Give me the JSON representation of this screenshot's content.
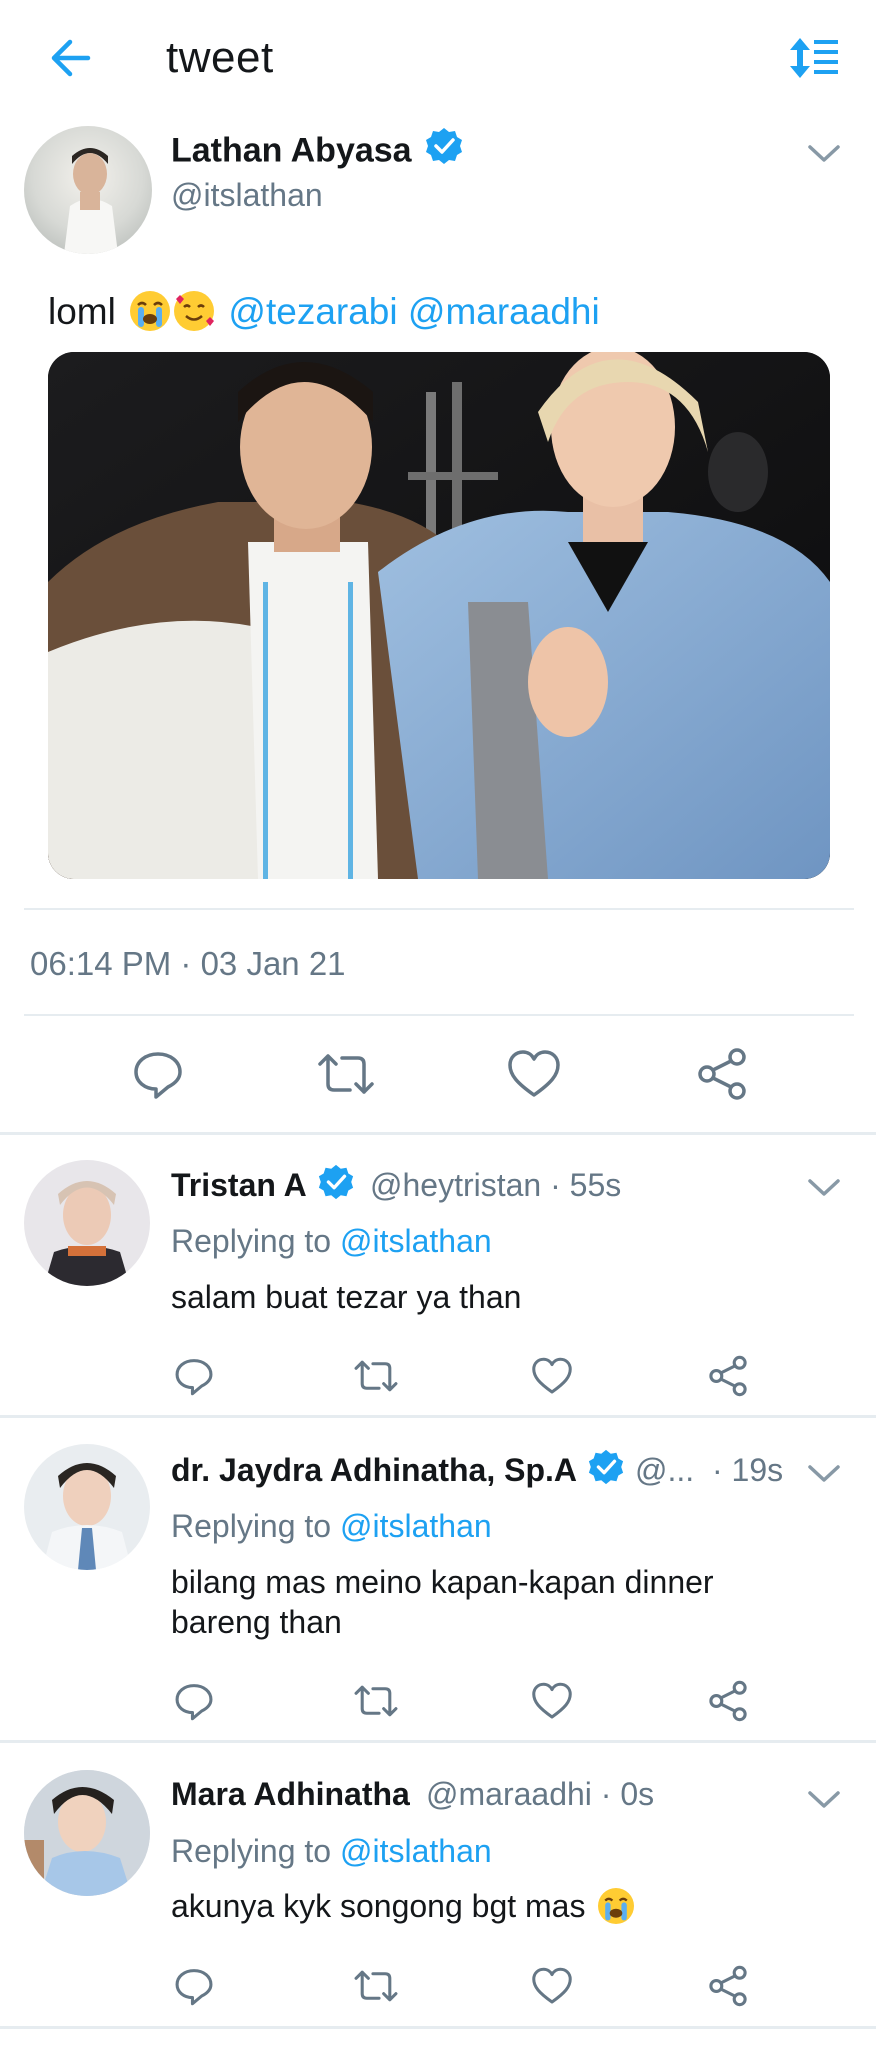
{
  "header": {
    "title": "tweet",
    "back_icon": "arrow-left-icon",
    "sort_icon": "sort-icon",
    "accent": "#1da1f2"
  },
  "main_tweet": {
    "name": "Lathan Abyasa",
    "handle": "@itslathan",
    "text_prefix": "loml",
    "emojis": [
      "crying-face-emoji",
      "smiling-face-with-hearts-emoji"
    ],
    "mentions": [
      "@tezarabi",
      "@maraadhi"
    ],
    "timestamp": "06:14 PM · 03 Jan 21",
    "actions": [
      "reply-icon",
      "retweet-icon",
      "like-icon",
      "share-icon"
    ]
  },
  "replies": [
    {
      "name": "Tristan A",
      "verified": true,
      "handle": "@heytristan",
      "time": "· 55s",
      "replying_label": "Replying to",
      "replying_to": "@itslathan",
      "text": "salam buat tezar ya than"
    },
    {
      "name": "dr. Jaydra Adhinatha, Sp.A",
      "verified": true,
      "handle": "@...",
      "time": "· 19s",
      "replying_label": "Replying to",
      "replying_to": "@itslathan",
      "text": "bilang mas meino kapan-kapan dinner bareng than"
    },
    {
      "name": "Mara Adhinatha",
      "verified": false,
      "handle": "@maraadhi",
      "time": "· 0s",
      "replying_label": "Replying to",
      "replying_to": "@itslathan",
      "text": "akunya kyk songong bgt mas"
    }
  ]
}
